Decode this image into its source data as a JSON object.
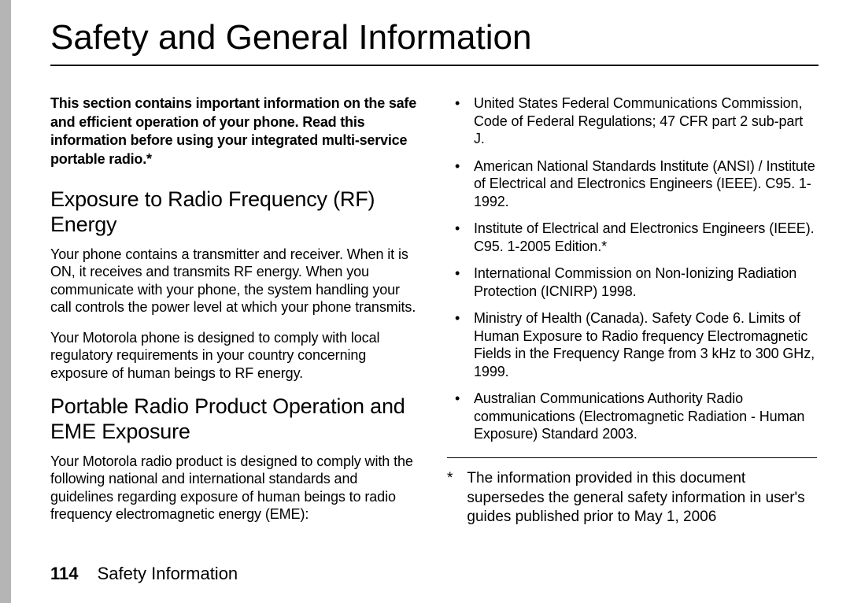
{
  "title": "Safety and General Information",
  "intro": "This section contains important information on the safe and efficient operation of your phone. Read this information before using your integrated multi-service portable radio.*",
  "section1": {
    "heading": "Exposure to Radio Frequency (RF) Energy",
    "p1": "Your phone contains a transmitter and receiver. When it is ON, it receives and transmits RF energy. When you communicate with your phone, the system handling your call controls the power level at which your phone transmits.",
    "p2": "Your Motorola phone is designed to comply with local regulatory requirements in your country concerning exposure of human beings to RF energy."
  },
  "section2": {
    "heading": "Portable Radio Product Operation and EME Exposure",
    "p1": "Your Motorola radio product is designed to comply with the following national and international standards and guidelines regarding exposure of human beings to radio frequency electromagnetic energy (EME):"
  },
  "standards": [
    "United States Federal Communications Commission, Code of Federal Regulations; 47 CFR part 2 sub-part J.",
    "American National Standards Institute (ANSI) / Institute of Electrical and Electronics Engineers (IEEE). C95. 1-1992.",
    "Institute of Electrical and Electronics Engineers (IEEE). C95. 1-2005 Edition.*",
    "International Commission on Non-Ionizing Radiation Protection (ICNIRP) 1998.",
    "Ministry of Health (Canada). Safety Code 6. Limits of Human Exposure to Radio frequency Electromagnetic Fields in the Frequency Range from 3 kHz to 300 GHz, 1999.",
    "Australian Communications Authority Radio communications (Electromagnetic Radiation - Human Exposure) Standard 2003."
  ],
  "footnote": {
    "marker": "*",
    "text": "The information provided in this document supersedes the general safety information in user's guides published prior to May 1, 2006"
  },
  "footer": {
    "page_number": "114",
    "section_name": "Safety Information"
  }
}
